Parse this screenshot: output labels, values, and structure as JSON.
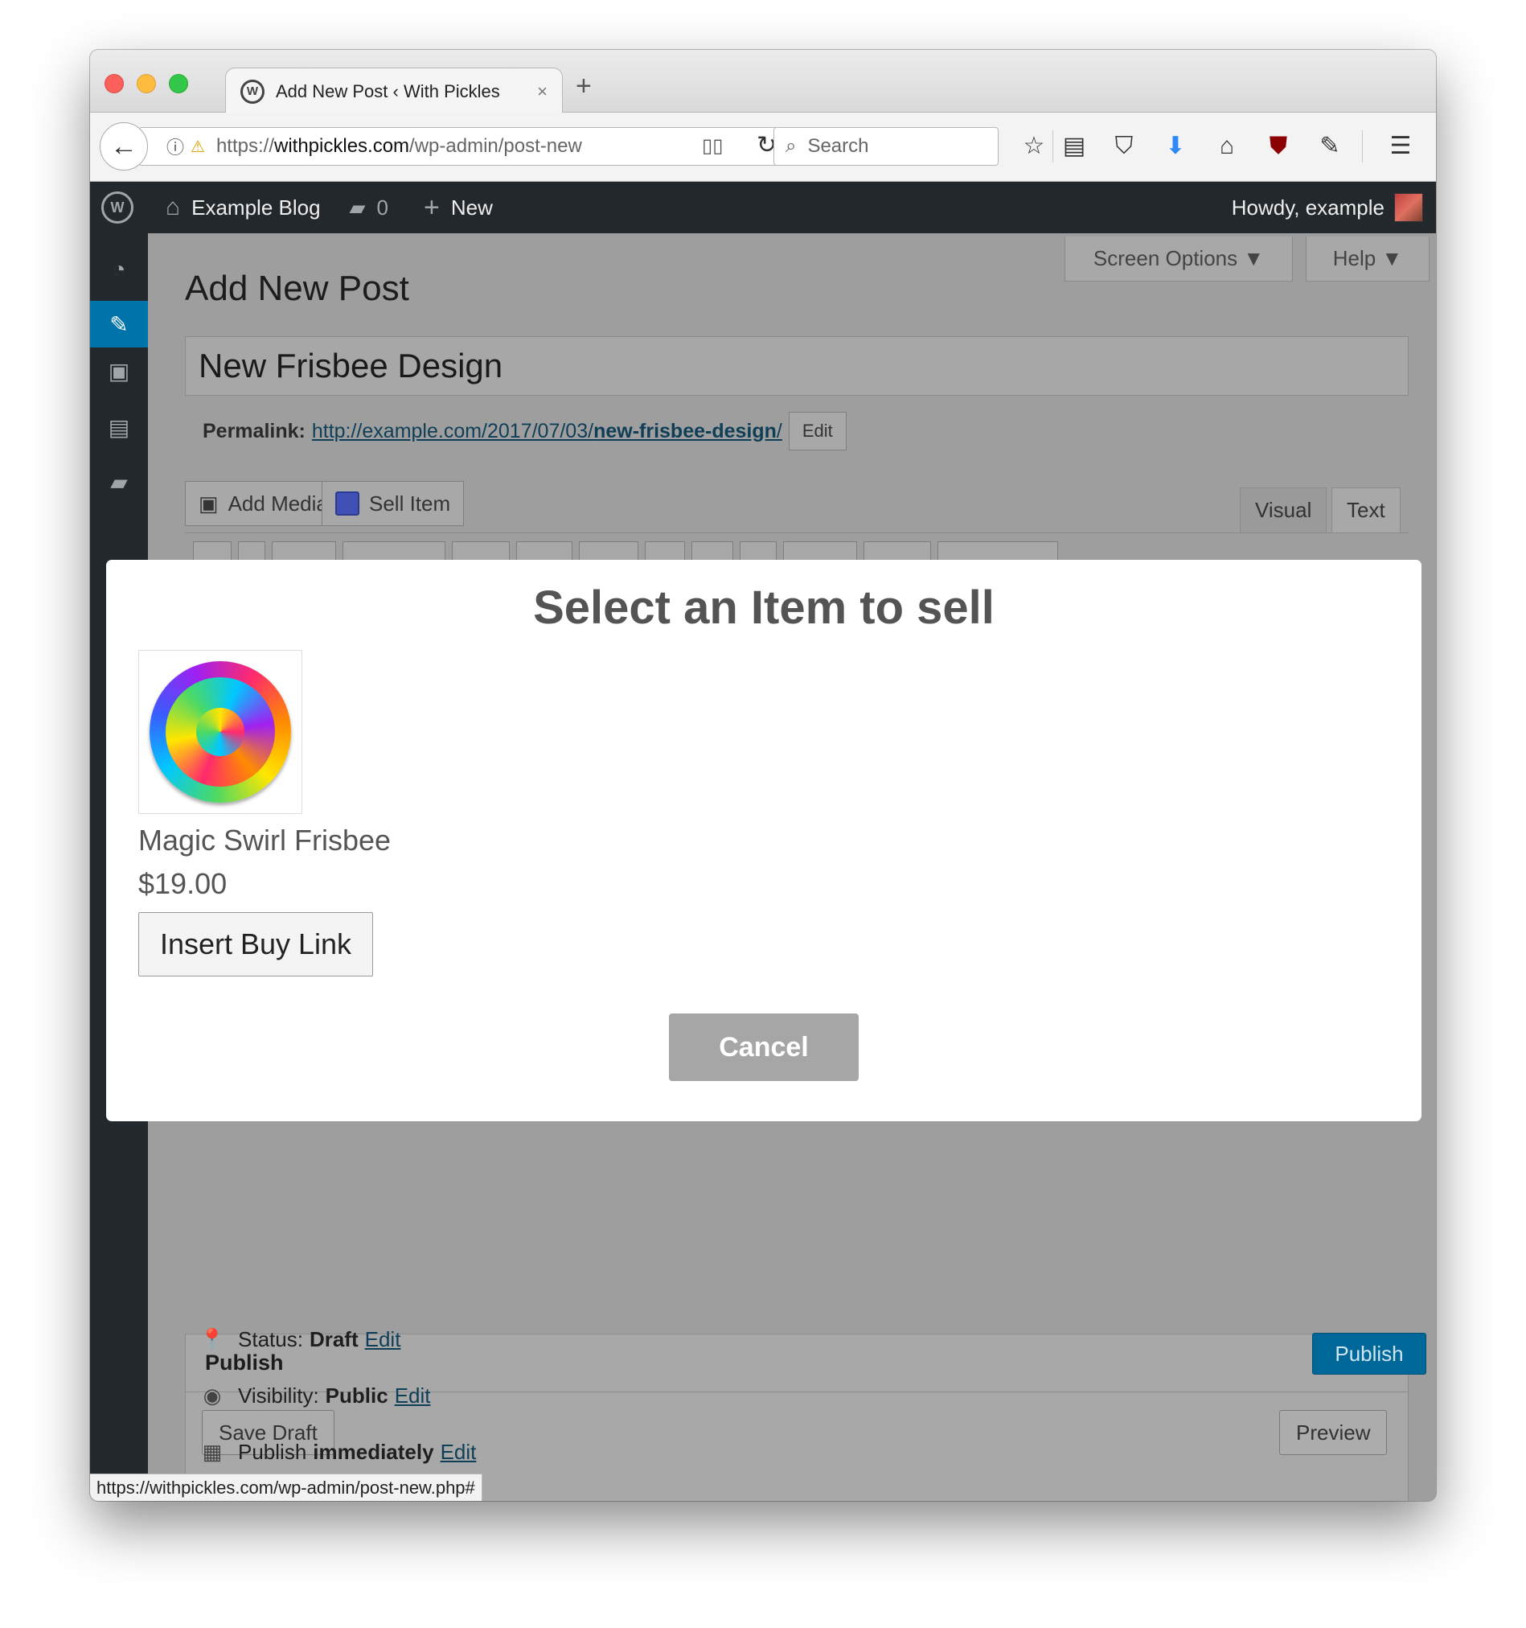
{
  "browser": {
    "tab_title": "Add New Post ‹ With Pickles",
    "tab_title_suffix": "-",
    "tab_close": "×",
    "new_tab": "+",
    "url_scheme": "https://",
    "url_host": "withpickles.com",
    "url_path": "/wp-admin/post-new",
    "search_placeholder": "Search",
    "status_url": "https://withpickles.com/wp-admin/post-new.php#"
  },
  "adminbar": {
    "site_name": "Example Blog",
    "comment_count": "0",
    "new_label": "New",
    "howdy": "Howdy, example"
  },
  "screen": {
    "screen_options": "Screen Options ▼",
    "help": "Help ▼",
    "page_title": "Add New Post",
    "post_title": "New Frisbee Design",
    "permalink_label": "Permalink:",
    "permalink_base": "http://example.com/2017/07/03/",
    "permalink_slug": "new-frisbee-design",
    "permalink_trailing": "/",
    "permalink_edit": "Edit",
    "add_media": "Add Media",
    "sell_item": "Sell Item",
    "tab_visual": "Visual",
    "tab_text": "Text"
  },
  "publish": {
    "title": "Publish",
    "save_draft": "Save Draft",
    "preview": "Preview",
    "status_label": "Status:",
    "status_value": "Draft",
    "visibility_label": "Visibility:",
    "visibility_value": "Public",
    "schedule_label": "Publish",
    "schedule_value": "immediately",
    "edit": "Edit",
    "publish_button": "Publish"
  },
  "modal": {
    "title": "Select an Item to sell",
    "item_name": "Magic Swirl Frisbee",
    "item_price": "$19.00",
    "insert_button": "Insert Buy Link",
    "cancel_button": "Cancel"
  },
  "colors": {
    "admin_bar": "#23282d",
    "accent": "#0073aa",
    "publish_button": "#006799",
    "cancel_button": "#a6a6a6"
  }
}
